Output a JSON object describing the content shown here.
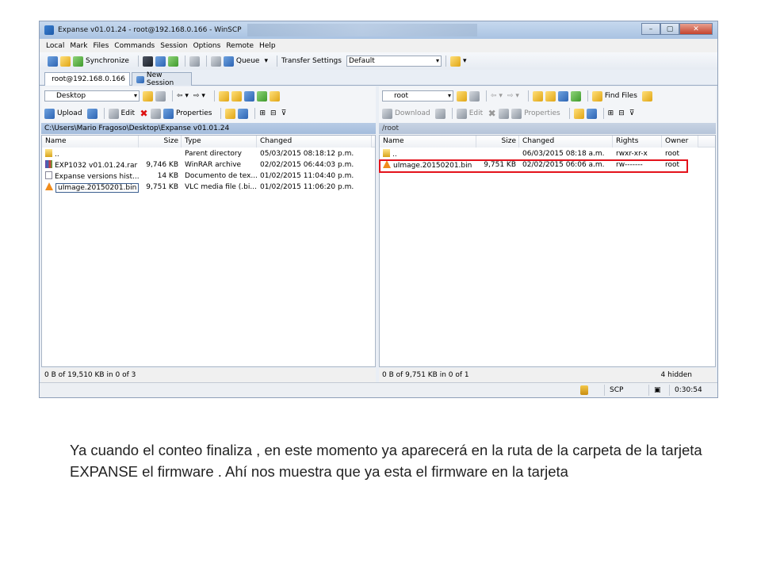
{
  "window": {
    "title": "Expanse v01.01.24 - root@192.168.0.166 - WinSCP",
    "controls": [
      "–",
      "▢",
      "✕"
    ]
  },
  "menu": [
    "Local",
    "Mark",
    "Files",
    "Commands",
    "Session",
    "Options",
    "Remote",
    "Help"
  ],
  "toolbar": {
    "synchronize": "Synchronize",
    "queue": "Queue",
    "transfer_settings": "Transfer Settings",
    "transfer_profile": "Default"
  },
  "tabs": {
    "session": "root@192.168.0.166",
    "new_session": "New Session"
  },
  "left": {
    "location": "Desktop",
    "actions": {
      "upload": "Upload",
      "edit": "Edit",
      "properties": "Properties"
    },
    "path": "C:\\Users\\Mario Fragoso\\Desktop\\Expanse v01.01.24",
    "columns": [
      "Name",
      "Size",
      "Type",
      "Changed"
    ],
    "files": [
      {
        "name": "..",
        "size": "",
        "type": "Parent directory",
        "changed": "05/03/2015  08:18:12 p.m.",
        "icon": "up-folder-icon"
      },
      {
        "name": "EXP1032 v01.01.24.rar",
        "size": "9,746 KB",
        "type": "WinRAR archive",
        "changed": "02/02/2015  06:44:03 p.m.",
        "icon": "rar-file-icon"
      },
      {
        "name": "Expanse versions hist...",
        "size": "14 KB",
        "type": "Documento de tex...",
        "changed": "01/02/2015  11:04:40 p.m.",
        "icon": "text-file-icon"
      },
      {
        "name": "uImage.20150201.bin",
        "size": "9,751 KB",
        "type": "VLC media file (.bi...",
        "changed": "01/02/2015  11:06:20 p.m.",
        "icon": "vlc-file-icon"
      }
    ],
    "status": "0 B of 19,510 KB in 0 of 3"
  },
  "right": {
    "location": "root",
    "actions": {
      "download": "Download",
      "edit": "Edit",
      "properties": "Properties",
      "find_files": "Find Files"
    },
    "path": "/root",
    "columns": [
      "Name",
      "Size",
      "Changed",
      "Rights",
      "Owner"
    ],
    "files": [
      {
        "name": "..",
        "size": "",
        "changed": "06/03/2015 08:18 a.m.",
        "rights": "rwxr-xr-x",
        "owner": "root",
        "icon": "up-folder-icon"
      },
      {
        "name": "uImage.20150201.bin",
        "size": "9,751 KB",
        "changed": "02/02/2015 06:06 a.m.",
        "rights": "rw-------",
        "owner": "root",
        "icon": "vlc-file-icon"
      }
    ],
    "status": "0 B of 9,751 KB in 0 of 1",
    "hidden": "4 hidden"
  },
  "statusbar": {
    "protocol": "SCP",
    "elapsed": "0:30:54"
  },
  "caption": "Ya cuando el conteo finaliza , en este momento ya aparecerá en la ruta de la carpeta de la tarjeta EXPANSE el firmware . Ahí nos muestra que ya esta el firmware en la tarjeta",
  "colors": {
    "highlight_box": "#e4121b",
    "title_bar": "#b8cde8",
    "path_bar_active": "#a9c0de"
  }
}
